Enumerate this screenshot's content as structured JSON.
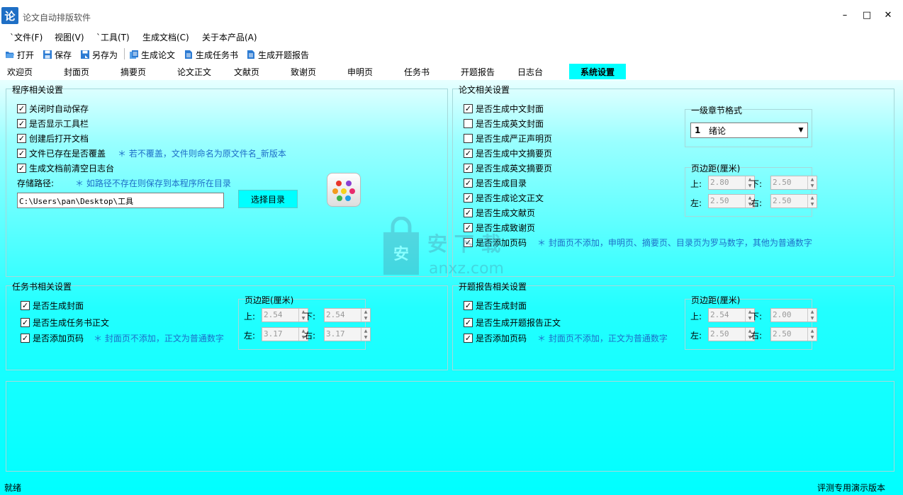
{
  "window": {
    "app_icon_char": "论",
    "title": "论文自动排版软件",
    "minimize": "–",
    "maximize": "□",
    "close": "✕"
  },
  "menu": [
    "`文件(F)",
    "视图(V)",
    "`工具(T)",
    "生成文档(C)",
    "关于本产品(A)"
  ],
  "toolbar": {
    "open": "打开",
    "save": "保存",
    "save_as": "另存为",
    "gen_paper": "生成论文",
    "gen_task": "生成任务书",
    "gen_proposal": "生成开题报告"
  },
  "tabs": [
    "欢迎页",
    "封面页",
    "摘要页",
    "论文正文",
    "文献页",
    "致谢页",
    "申明页",
    "任务书",
    "开题报告",
    "日志台",
    "系统设置"
  ],
  "active_tab": "系统设置",
  "program": {
    "title": "程序相关设置",
    "options": [
      {
        "label": "关闭时自动保存",
        "checked": true
      },
      {
        "label": "是否显示工具栏",
        "checked": true
      },
      {
        "label": "创建后打开文档",
        "checked": true
      },
      {
        "label": "文件已存在是否覆盖",
        "checked": true
      },
      {
        "label": "生成文档前清空日志台",
        "checked": true
      }
    ],
    "overwrite_note": "＊ 若不覆盖，文件则命名为原文件名_新版本",
    "path_label": "存储路径:",
    "path_note": "＊ 如路径不存在则保存到本程序所在目录",
    "path_value": "C:\\Users\\pan\\Desktop\\工具",
    "choose_dir": "选择目录"
  },
  "paper": {
    "title": "论文相关设置",
    "options": [
      {
        "label": "是否生成中文封面",
        "checked": true
      },
      {
        "label": "是否生成英文封面",
        "checked": false
      },
      {
        "label": "是否生成严正声明页",
        "checked": false
      },
      {
        "label": "是否生成中文摘要页",
        "checked": true
      },
      {
        "label": "是否生成英文摘要页",
        "checked": true
      },
      {
        "label": "是否生成目录",
        "checked": true
      },
      {
        "label": "是否生成论文正文",
        "checked": true
      },
      {
        "label": "是否生成文献页",
        "checked": true
      },
      {
        "label": "是否生成致谢页",
        "checked": true
      },
      {
        "label": "是否添加页码",
        "checked": true
      }
    ],
    "page_num_note": "＊ 封面页不添加，申明页、摘要页、目录页为罗马数字，其他为普通数字",
    "heading_title": "一级章节格式",
    "heading_num": "1",
    "heading_value": "绪论",
    "margin_title": "页边距(厘米)",
    "margins": {
      "top_label": "上:",
      "top": "2.80",
      "bottom_label": "下:",
      "bottom": "2.50",
      "left_label": "左:",
      "left": "2.50",
      "right_label": "右:",
      "right": "2.50"
    }
  },
  "task": {
    "title": "任务书相关设置",
    "options": [
      {
        "label": "是否生成封面",
        "checked": true
      },
      {
        "label": "是否生成任务书正文",
        "checked": true
      },
      {
        "label": "是否添加页码",
        "checked": true
      }
    ],
    "page_num_note": "＊ 封面页不添加，正文为普通数字",
    "margin_title": "页边距(厘米)",
    "margins": {
      "top_label": "上:",
      "top": "2.54",
      "bottom_label": "下:",
      "bottom": "2.54",
      "left_label": "左:",
      "left": "3.17",
      "right_label": "右:",
      "right": "3.17"
    }
  },
  "proposal": {
    "title": "开题报告相关设置",
    "options": [
      {
        "label": "是否生成封面",
        "checked": true
      },
      {
        "label": "是否生成开题报告正文",
        "checked": true
      },
      {
        "label": "是否添加页码",
        "checked": true
      }
    ],
    "page_num_note": "＊ 封面页不添加，正文为普通数字",
    "margin_title": "页边距(厘米)",
    "margins": {
      "top_label": "上:",
      "top": "2.54",
      "bottom_label": "下:",
      "bottom": "2.00",
      "left_label": "左:",
      "left": "2.50",
      "right_label": "右:",
      "right": "2.50"
    }
  },
  "status": {
    "left": "就绪",
    "right": "评测专用演示版本"
  },
  "watermark": {
    "char": "安",
    "text_cn": "安 下 载",
    "text_en": "anxz.com"
  }
}
